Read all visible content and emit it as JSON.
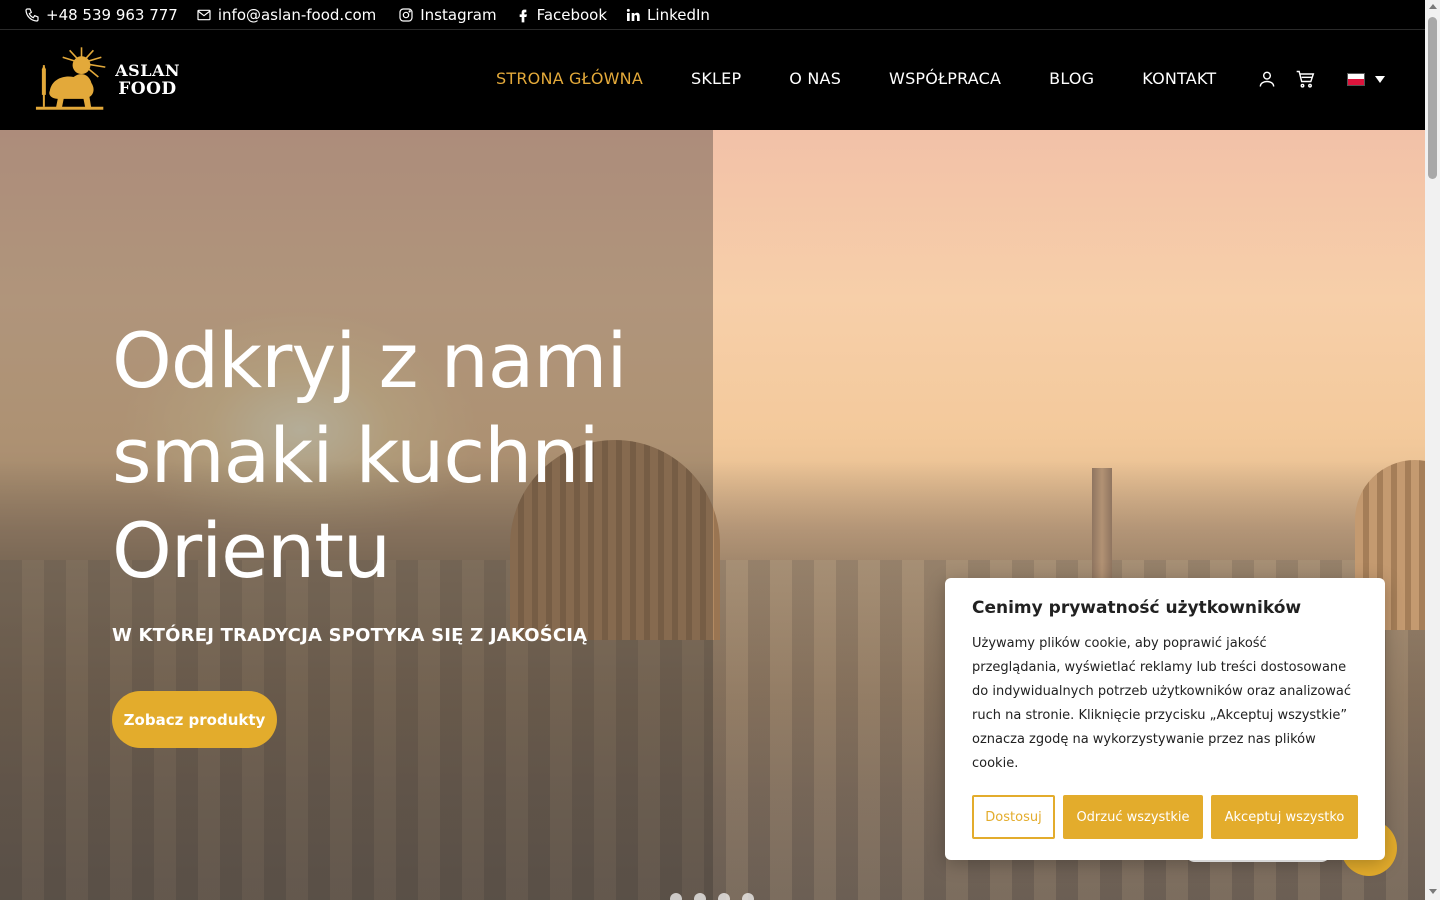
{
  "topbar": {
    "phone": "+48 539 963 777",
    "email": "info@aslan-food.com",
    "instagram": "Instagram",
    "facebook": "Facebook",
    "linkedin": "LinkedIn"
  },
  "logo": {
    "line1": "ASLAN",
    "line2": "FOOD"
  },
  "nav": {
    "items": [
      {
        "label": "STRONA GŁÓWNA",
        "active": true
      },
      {
        "label": "SKLEP"
      },
      {
        "label": "O NAS"
      },
      {
        "label": "WSPÓŁPRACA"
      },
      {
        "label": "BLOG"
      },
      {
        "label": "KONTAKT"
      }
    ],
    "icons": [
      "user-icon",
      "cart-icon"
    ]
  },
  "hero": {
    "title": "Odkryj z nami smaki kuchni Orientu",
    "subtitle": "W KTÓREJ TRADYCJA SPOTYKA SIĘ Z JAKOŚCIĄ",
    "button": "Zobacz produkty",
    "slides": 4
  },
  "cookie": {
    "title": "Cenimy prywatność użytkowników",
    "text": "Używamy plików cookie, aby poprawić jakość przeglądania, wyświetlać reklamy lub treści dostosowane do indywidualnych potrzeb użytkowników oraz analizować ruch na stronie. Kliknięcie przycisku „Akceptuj wszystkie” oznacza zgodę na wykorzystywanie przez nas plików cookie.",
    "customize": "Dostosuj",
    "reject": "Odrzuć wszystkie",
    "accept": "Akceptuj wszystko"
  },
  "colors": {
    "accent": "#e3ac2c",
    "active_nav": "#e3a93a",
    "header_bg": "#000000"
  }
}
